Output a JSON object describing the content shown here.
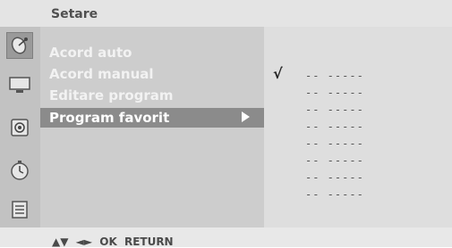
{
  "header": {
    "title": "Setare"
  },
  "icons": [
    {
      "name": "satellite-dish-icon",
      "active": true
    },
    {
      "name": "tv-screen-icon",
      "active": false
    },
    {
      "name": "speaker-icon",
      "active": false
    },
    {
      "name": "clock-icon",
      "active": false
    },
    {
      "name": "options-icon",
      "active": false
    }
  ],
  "menu": {
    "items": [
      {
        "label": "Acord auto"
      },
      {
        "label": "Acord manual"
      },
      {
        "label": "Editare program"
      }
    ],
    "selected_label": "Program favorit"
  },
  "favorites": {
    "check_mark": "√",
    "rows": [
      "--  -----",
      "--  -----",
      "--  -----",
      "--  -----",
      "--  -----",
      "--  -----",
      "--  -----",
      "--  -----"
    ]
  },
  "footer": {
    "text": "▲▼ ◄► OK RETURN"
  },
  "colors": {
    "background": "#d9d9d9",
    "selection": "#8b8b8b",
    "menu_text": "#f2f2f2"
  }
}
